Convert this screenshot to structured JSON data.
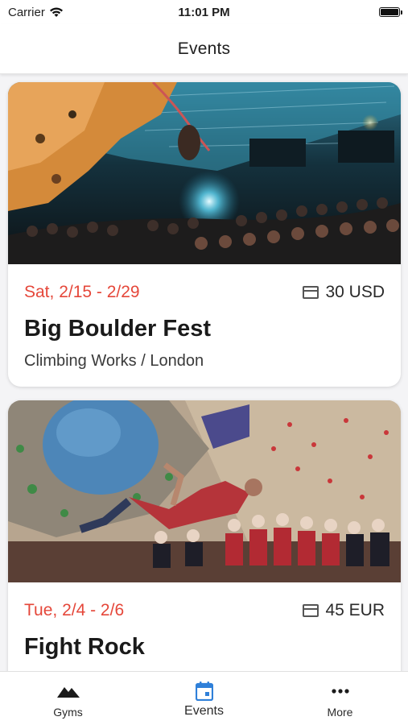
{
  "status_bar": {
    "carrier": "Carrier",
    "time": "11:01 PM",
    "battery_level": 1.0
  },
  "header": {
    "title": "Events"
  },
  "events": [
    {
      "date": "Sat, 2/15 - 2/29",
      "price": "30 USD",
      "title": "Big Boulder Fest",
      "location": "Climbing Works / London"
    },
    {
      "date": "Tue, 2/4 - 2/6",
      "price": "45 EUR",
      "title": "Fight Rock"
    }
  ],
  "tabs": [
    {
      "label": "Gyms",
      "icon": "mountain-icon",
      "active": false
    },
    {
      "label": "Events",
      "icon": "calendar-icon",
      "active": true
    },
    {
      "label": "More",
      "icon": "more-dots-icon",
      "active": false
    }
  ],
  "colors": {
    "accent": "#2f80d9",
    "date": "#e5473a",
    "text": "#1f1f1f"
  }
}
